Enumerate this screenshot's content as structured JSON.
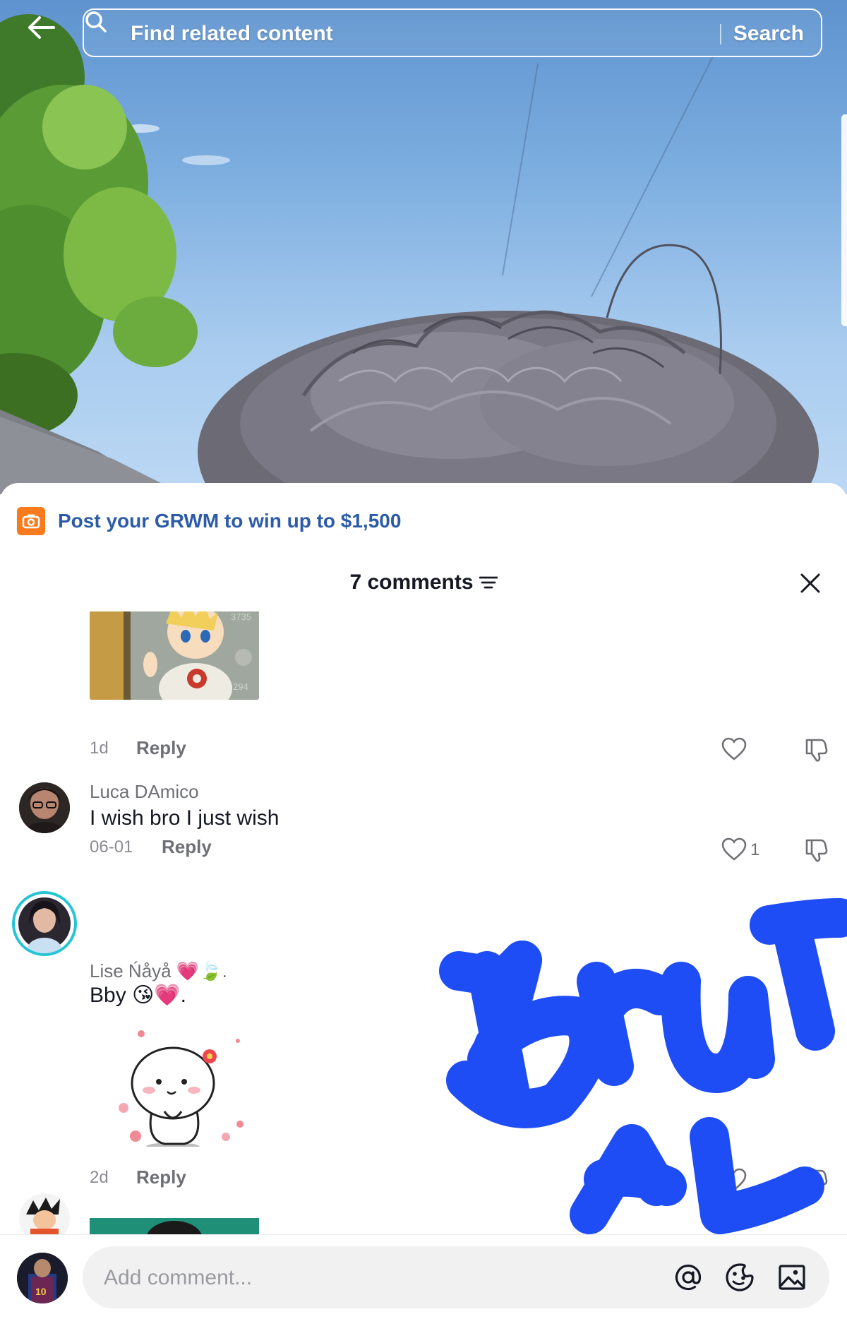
{
  "topbar": {
    "search_placeholder": "Find related content",
    "search_button": "Search"
  },
  "promo": {
    "text": "Post your GRWM to win up to $1,500"
  },
  "comments_header": {
    "title": "7 comments"
  },
  "comments": [
    {
      "type": "image",
      "time": "1d",
      "reply_label": "Reply"
    },
    {
      "type": "text",
      "username": "Luca DAmico",
      "text": "I wish bro I just wish",
      "time": "06-01",
      "reply_label": "Reply",
      "likes": "1"
    },
    {
      "type": "sticker",
      "username": "Lise Ńåyå 💗🍃.",
      "text": "Bby 😘💗.",
      "time": "2d",
      "reply_label": "Reply"
    }
  ],
  "input": {
    "placeholder": "Add comment..."
  },
  "overlay": {
    "handwriting": "BruT AL",
    "color": "#1f4df5"
  },
  "colors": {
    "promo_accent": "#fa7a1e",
    "promo_text": "#2c5ca8"
  }
}
